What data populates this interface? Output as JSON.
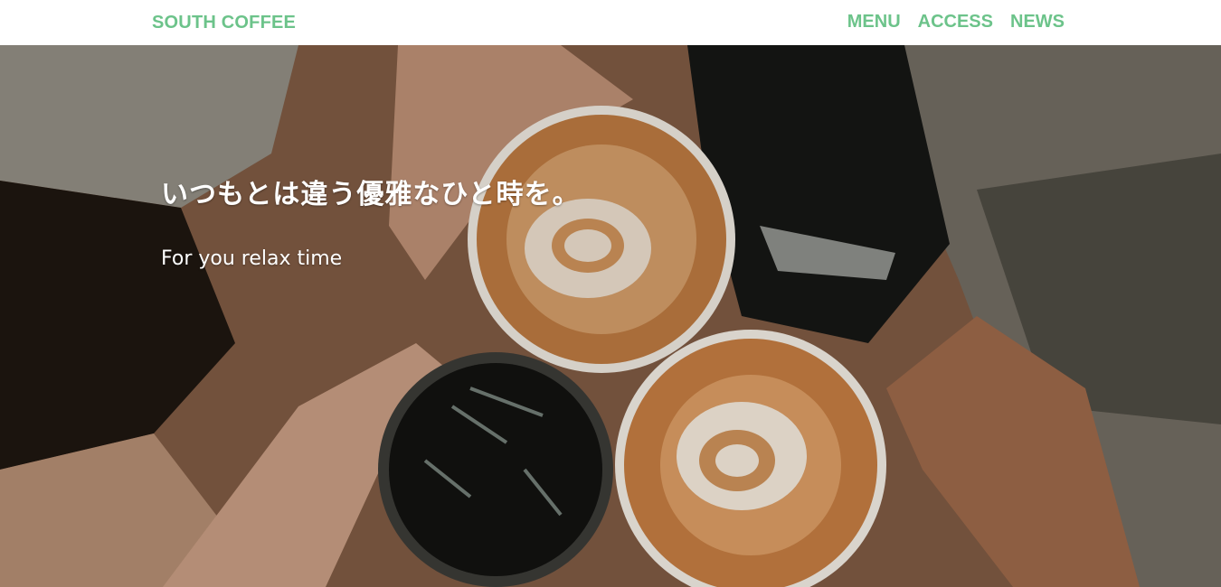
{
  "header": {
    "logo": "SOUTH COFFEE",
    "nav": [
      {
        "label": "MENU"
      },
      {
        "label": "ACCESS"
      },
      {
        "label": "NEWS"
      }
    ]
  },
  "hero": {
    "headline": "いつもとは違う優雅なひと時を。",
    "subline": "For you relax time"
  },
  "colors": {
    "accent": "#6cc38a",
    "header_bg": "#ffffff",
    "hero_text": "#ffffff"
  }
}
